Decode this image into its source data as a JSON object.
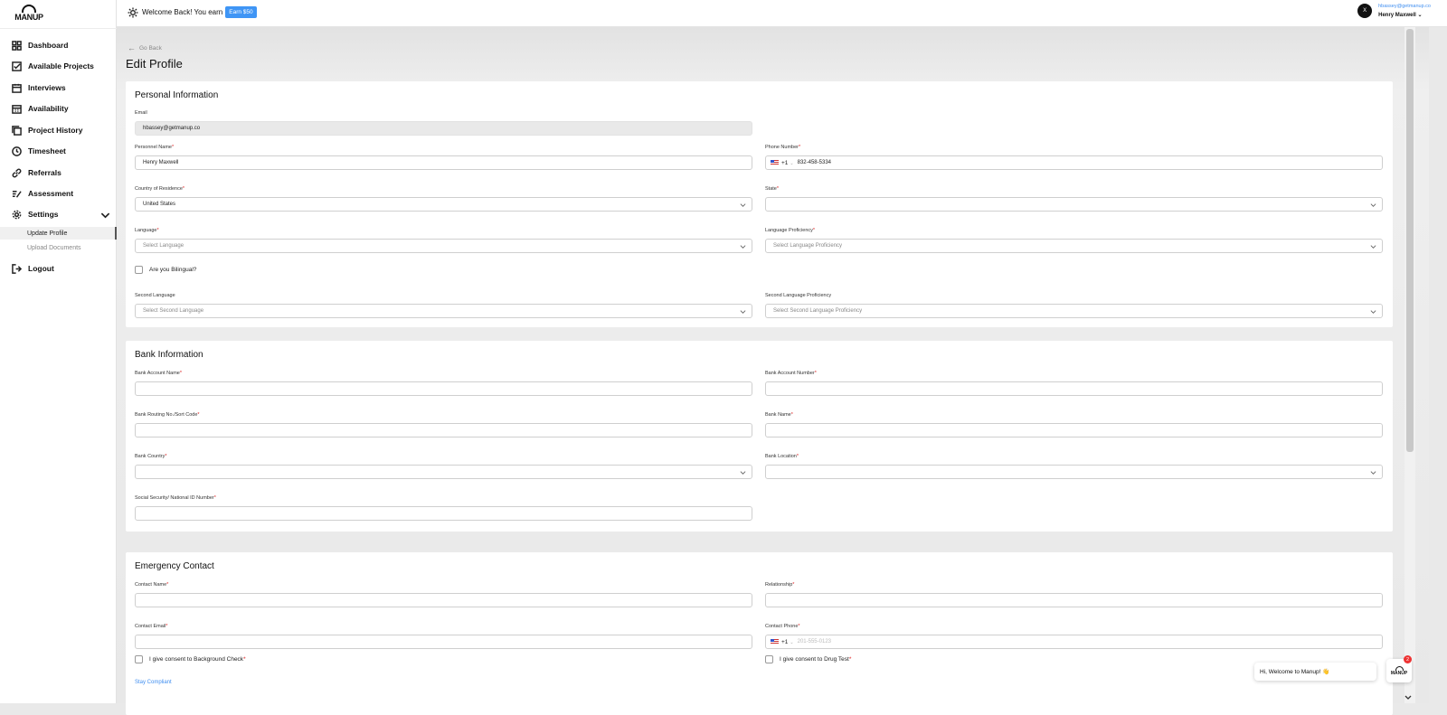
{
  "brand": {
    "name": "MANUP"
  },
  "sidebar": {
    "items": [
      {
        "label": "Dashboard",
        "icon": "grid-icon"
      },
      {
        "label": "Available Projects",
        "icon": "checkbox-icon"
      },
      {
        "label": "Interviews",
        "icon": "calendar-icon"
      },
      {
        "label": "Availability",
        "icon": "calendar-grid-icon"
      },
      {
        "label": "Project History",
        "icon": "stack-icon"
      },
      {
        "label": "Timesheet",
        "icon": "clock-icon"
      },
      {
        "label": "Referrals",
        "icon": "link-icon"
      },
      {
        "label": "Assessment",
        "icon": "list-check-icon"
      },
      {
        "label": "Settings",
        "icon": "gear-icon"
      }
    ],
    "settings_sub": [
      {
        "label": "Update Profile",
        "active": true
      },
      {
        "label": "Upload Documents",
        "active": false
      }
    ],
    "logout": "Logout"
  },
  "topbar": {
    "welcome": "Welcome Back! You earn",
    "earn_badge": "Earn $50",
    "user_email": "hbassey@getmanup.co",
    "user_name": "Henry Maxwell",
    "avatar_initial": "X"
  },
  "page": {
    "go_back": "Go Back",
    "title": "Edit Profile"
  },
  "personal": {
    "heading": "Personal Information",
    "email_label": "Email",
    "email_value": "hbassey@getmanup.co",
    "name_label": "Personnel Name",
    "name_value": "Henry Maxwell",
    "phone_label": "Phone Number",
    "phone_code": "+1",
    "phone_value": "832-458-5334",
    "country_label": "Country of Residence",
    "country_value": "United States",
    "state_label": "State",
    "language_label": "Language",
    "language_placeholder": "Select Language",
    "proficiency_label": "Language Proficiency",
    "proficiency_placeholder": "Select Language Proficiency",
    "bilingual_label": "Are you Bilingual?",
    "second_language_label": "Second Language",
    "second_language_placeholder": "Select Second Language",
    "second_proficiency_label": "Second Language Proficiency",
    "second_proficiency_placeholder": "Select Second Language Proficiency"
  },
  "bank": {
    "heading": "Bank Information",
    "account_name_label": "Bank Account Name",
    "account_number_label": "Bank Account Number",
    "routing_label": "Bank Routing No./Sort Code",
    "bank_name_label": "Bank Name",
    "country_label": "Bank Country",
    "location_label": "Bank Location",
    "ssn_label": "Social Security/ National ID Number"
  },
  "emergency": {
    "heading": "Emergency Contact",
    "contact_name_label": "Contact Name",
    "relationship_label": "Relationship",
    "contact_email_label": "Contact Email",
    "contact_phone_label": "Contact Phone",
    "contact_phone_code": "+1",
    "contact_phone_placeholder": "201-555-0123",
    "background_consent": "I give consent to Background Check",
    "drug_consent": "I give consent to Drug Test",
    "stay_compliant": "Stay Compliant"
  },
  "chat": {
    "greeting": "Hi, Welcome to Manup! 👋",
    "badge_count": "2",
    "brand": "MANUP"
  }
}
